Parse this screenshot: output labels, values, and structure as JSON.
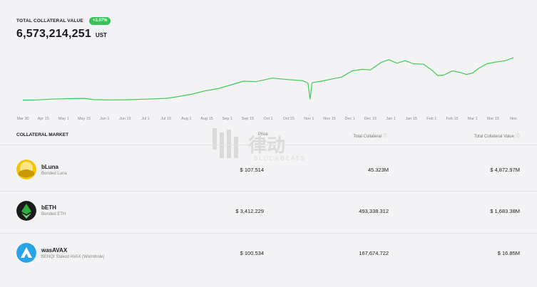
{
  "header": {
    "title": "TOTAL COLLATERAL VALUE",
    "change_badge": "+3.07%",
    "value": "6,573,214,251",
    "unit": "UST"
  },
  "colors": {
    "accent_green": "#36c25a",
    "line_green": "#3fcc52",
    "bluna_yellow": "#f5c400",
    "beth_green": "#2fae3e",
    "wasavax_blue": "#2aa4e8"
  },
  "chart_data": {
    "type": "line",
    "title": "",
    "xlabel": "",
    "ylabel": "",
    "grid": false,
    "legend": "none",
    "x_ticks": [
      "Mar 30",
      "Apr 15",
      "May 1",
      "May 15",
      "Jun 1",
      "Jun 15",
      "Jul 1",
      "Jul 15",
      "Aug 1",
      "Aug 15",
      "Sep 1",
      "Sep 15",
      "Oct 1",
      "Oct 15",
      "Nov 1",
      "Nov 15",
      "Dec 1",
      "Dec 15",
      "Jan 1",
      "Jan 15",
      "Feb 1",
      "Feb 15",
      "Mar 1",
      "Mar 15",
      "Nov"
    ],
    "ylim": [
      0,
      100
    ],
    "series": [
      {
        "values": [
          [
            0,
            13
          ],
          [
            0.7,
            13.5
          ],
          [
            1.4,
            15
          ],
          [
            2.2,
            16
          ],
          [
            3,
            16.5
          ],
          [
            3.5,
            14
          ],
          [
            4.2,
            13.5
          ],
          [
            5,
            13.8
          ],
          [
            6,
            15
          ],
          [
            7,
            16.5
          ],
          [
            7.6,
            20
          ],
          [
            8.3,
            25
          ],
          [
            8.9,
            31
          ],
          [
            9.6,
            36
          ],
          [
            10.2,
            43
          ],
          [
            10.8,
            50
          ],
          [
            11.4,
            49
          ],
          [
            12.2,
            56
          ],
          [
            13,
            53
          ],
          [
            13.7,
            51
          ],
          [
            13.95,
            46
          ],
          [
            14.05,
            15
          ],
          [
            14.15,
            47
          ],
          [
            14.6,
            50
          ],
          [
            15.2,
            55
          ],
          [
            15.6,
            58
          ],
          [
            16.1,
            70
          ],
          [
            16.6,
            73
          ],
          [
            17,
            72
          ],
          [
            17.5,
            86
          ],
          [
            17.9,
            92
          ],
          [
            18.3,
            85
          ],
          [
            18.7,
            90
          ],
          [
            19.1,
            84
          ],
          [
            19.6,
            83
          ],
          [
            20,
            72
          ],
          [
            20.3,
            61
          ],
          [
            20.6,
            62
          ],
          [
            21,
            70
          ],
          [
            21.4,
            67
          ],
          [
            21.7,
            63
          ],
          [
            22,
            66
          ],
          [
            22.3,
            75
          ],
          [
            22.7,
            84
          ],
          [
            23.1,
            87
          ],
          [
            23.6,
            90
          ],
          [
            24,
            96
          ]
        ]
      }
    ]
  },
  "market": {
    "title": "COLLATERAL MARKET",
    "col_price": "Price",
    "col_total": "Total Collateral",
    "col_value": "Total Collateral Value",
    "rows": [
      {
        "symbol": "bLuna",
        "name": "Bonded Luna",
        "price": "$ 107.514",
        "total": "45.323M",
        "value": "$ 4,872.97M",
        "icon": "bluna-icon"
      },
      {
        "symbol": "bETH",
        "name": "Bonded ETH",
        "price": "$ 3,412.229",
        "total": "493,338.312",
        "value": "$ 1,683.38M",
        "icon": "beth-icon"
      },
      {
        "symbol": "wasAVAX",
        "name": "BENQI Staked AVAX (Wormhole)",
        "price": "$ 100.534",
        "total": "167,674.722",
        "value": "$ 16.85M",
        "icon": "wasavax-icon"
      }
    ]
  },
  "watermark": {
    "text": "律动",
    "sub": "BLOCKBEATS"
  }
}
